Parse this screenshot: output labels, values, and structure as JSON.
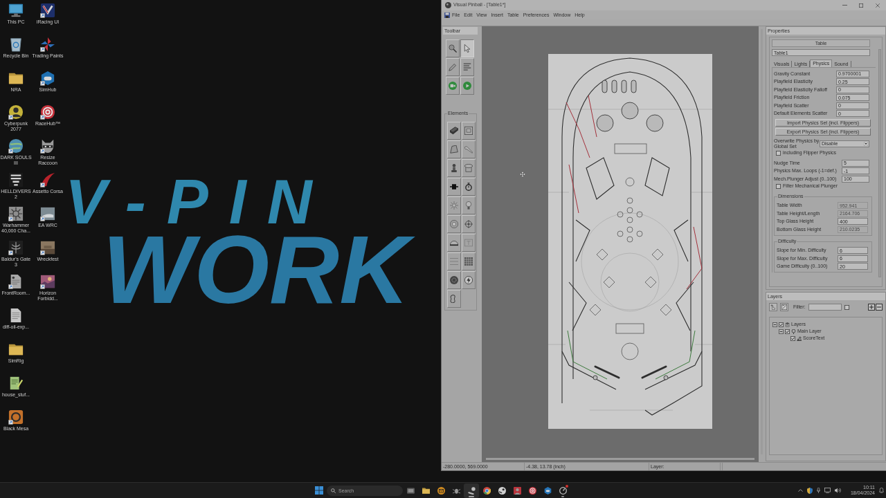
{
  "desktop": {
    "wallpaper_logo": [
      "V-PIN",
      "WORK"
    ],
    "icon_columns": [
      [
        {
          "label": "This PC",
          "kind": "monitor",
          "shortcut": false
        },
        {
          "label": "Recycle Bin",
          "kind": "bin",
          "shortcut": false
        },
        {
          "label": "NRA",
          "kind": "folder",
          "shortcut": false
        },
        {
          "label": "Cyberpunk 2077",
          "kind": "portrait",
          "shortcut": true
        },
        {
          "label": "DARK SOULS III",
          "kind": "globe",
          "shortcut": true
        },
        {
          "label": "HELLDIVERS 2",
          "kind": "emblem",
          "shortcut": false
        },
        {
          "label": "Warhammer 40,000 Cha...",
          "kind": "sun",
          "shortcut": true
        },
        {
          "label": "Baldur's Gate 3",
          "kind": "crest",
          "shortcut": true
        },
        {
          "label": "FrontRoom...",
          "kind": "imagefile",
          "shortcut": true
        },
        {
          "label": "diff-oil-exp...",
          "kind": "document",
          "shortcut": false
        },
        {
          "label": "SimRig",
          "kind": "folder",
          "shortcut": false
        },
        {
          "label": "house_stuf...",
          "kind": "notepad",
          "shortcut": false
        },
        {
          "label": "Black Mesa",
          "kind": "ringtile",
          "shortcut": true
        }
      ],
      [
        {
          "label": "iRacing UI",
          "kind": "shield",
          "shortcut": true
        },
        {
          "label": "Trading Paints",
          "kind": "pinwheel",
          "shortcut": true
        },
        {
          "label": "SimHub",
          "kind": "gamepad",
          "shortcut": true
        },
        {
          "label": "RaceHub™",
          "kind": "spiral",
          "shortcut": true
        },
        {
          "label": "Resize Raccoon",
          "kind": "mascot",
          "shortcut": true
        },
        {
          "label": "Assetto Corsa",
          "kind": "swoosh",
          "shortcut": true
        },
        {
          "label": "EA WRC",
          "kind": "rally",
          "shortcut": true
        },
        {
          "label": "Wreckfest",
          "kind": "wreck",
          "shortcut": true
        },
        {
          "label": "Horizon Forbidd...",
          "kind": "sunset",
          "shortcut": true
        }
      ]
    ]
  },
  "window": {
    "title": "Visual Pinball - [Table1*]",
    "menu": [
      "File",
      "Edit",
      "View",
      "Insert",
      "Table",
      "Preferences",
      "Window",
      "Help"
    ],
    "toolbar": {
      "title": "Toolbar",
      "tools": [
        {
          "kind": "magnifier",
          "selected": false
        },
        {
          "kind": "select",
          "selected": true
        },
        {
          "kind": "pencil",
          "selected": false
        },
        {
          "kind": "script",
          "selected": false
        },
        {
          "kind": "camera",
          "selected": false
        },
        {
          "kind": "play",
          "selected": false
        }
      ],
      "elements_title": "Elements",
      "elements": [
        {
          "kind": "wall",
          "selected": false
        },
        {
          "kind": "gate",
          "selected": false
        },
        {
          "kind": "ramp",
          "selected": false
        },
        {
          "kind": "flipper",
          "selected": false
        },
        {
          "kind": "plunger",
          "selected": false
        },
        {
          "kind": "bumper",
          "selected": false
        },
        {
          "kind": "spinner",
          "selected": false
        },
        {
          "kind": "timer",
          "selected": false
        },
        {
          "kind": "trigger",
          "selected": false
        },
        {
          "kind": "light",
          "selected": false
        },
        {
          "kind": "kicker",
          "selected": false
        },
        {
          "kind": "target",
          "selected": false
        },
        {
          "kind": "decal",
          "selected": false
        },
        {
          "kind": "textbox",
          "selected": false
        },
        {
          "kind": "reel",
          "selected": false
        },
        {
          "kind": "lightseq",
          "selected": false
        },
        {
          "kind": "primitive",
          "selected": false
        },
        {
          "kind": "flasher",
          "selected": false
        },
        {
          "kind": "rubber",
          "selected": false
        }
      ]
    },
    "properties": {
      "title": "Properties",
      "object_type": "Table",
      "object_name": "Table1",
      "tabs": [
        {
          "label": "Visuals",
          "selected": false
        },
        {
          "label": "Lights",
          "selected": false
        },
        {
          "label": "Physics",
          "selected": true
        },
        {
          "label": "Sound",
          "selected": false
        }
      ],
      "physics_fields": [
        {
          "label": "Gravity Constant",
          "value": "0.9700001",
          "disabled": false
        },
        {
          "label": "Playfield Elasticity",
          "value": "0.25",
          "disabled": false
        },
        {
          "label": "Playfield Elasticity Falloff",
          "value": "0",
          "disabled": false
        },
        {
          "label": "Playfield Friction",
          "value": "0.075",
          "disabled": false
        },
        {
          "label": "Playfield Scatter",
          "value": "0",
          "disabled": false
        },
        {
          "label": "Default Elements Scatter",
          "value": "0",
          "disabled": false
        }
      ],
      "buttons": [
        "Import Physics Set (incl. Flippers)",
        "Export Physics Set (incl. Flippers)"
      ],
      "overwrite": {
        "label": "Overwrite Physics by Global Set",
        "value": "Disable"
      },
      "flipper_option": {
        "label": "including Flipper Physics",
        "checked": false
      },
      "nudge_fields": [
        {
          "label": "Nudge Time",
          "value": "5",
          "disabled": false
        },
        {
          "label": "Physics Max. Loops (-1=def.)",
          "value": "-1",
          "disabled": false
        },
        {
          "label": "Mech.Plunger Adjust (0..100)",
          "value": "100",
          "disabled": false
        }
      ],
      "plunger_option": {
        "label": "Filter Mechanical Plunger",
        "checked": false
      },
      "groups": [
        {
          "title": "Dimensions",
          "fields": [
            {
              "label": "Table Width",
              "value": "952.941",
              "disabled": true
            },
            {
              "label": "Table Height/Length",
              "value": "2164.706",
              "disabled": true
            },
            {
              "label": "Top Glass Height",
              "value": "400",
              "disabled": false
            },
            {
              "label": "Bottom Glass Height",
              "value": "210.0235",
              "disabled": true
            }
          ]
        },
        {
          "title": "Difficulty",
          "fields": [
            {
              "label": "Slope for Min. Difficulty",
              "value": "6",
              "disabled": false
            },
            {
              "label": "Slope for Max. Difficulty",
              "value": "6",
              "disabled": false
            },
            {
              "label": "Game Difficulty (0..100)",
              "value": "20",
              "disabled": false
            }
          ]
        }
      ]
    },
    "layers": {
      "title": "Layers",
      "filter_label": "Filter:",
      "filter_option_checked": false,
      "tree": [
        {
          "label": "Layers",
          "kind": "stack",
          "checked": true,
          "expanded": true,
          "children": [
            {
              "label": "Main Layer",
              "kind": "pin",
              "checked": true,
              "expanded": true,
              "children": [
                {
                  "label": "ScoreText",
                  "kind": "shapes",
                  "checked": true
                }
              ]
            }
          ]
        }
      ]
    },
    "status_bar": [
      "-280.0000, 569.0000",
      "-4.38, 13.78 (inch)",
      "Layer:"
    ]
  },
  "taskbar": {
    "search_placeholder": "Search",
    "apps": [
      {
        "kind": "taskview",
        "active": false,
        "running": false,
        "badge": false
      },
      {
        "kind": "folder",
        "active": false,
        "running": false,
        "badge": false
      },
      {
        "kind": "mail",
        "active": false,
        "running": false,
        "badge": false
      },
      {
        "kind": "bug",
        "active": false,
        "running": false,
        "badge": false
      },
      {
        "kind": "pinball",
        "active": true,
        "running": true,
        "badge": false
      },
      {
        "kind": "chrome",
        "active": false,
        "running": false,
        "badge": false
      },
      {
        "kind": "roundlogo",
        "active": false,
        "running": false,
        "badge": false
      },
      {
        "kind": "avatar",
        "active": false,
        "running": false,
        "badge": false
      },
      {
        "kind": "spiral",
        "active": false,
        "running": false,
        "badge": false
      },
      {
        "kind": "gamepad",
        "active": false,
        "running": false,
        "badge": false
      },
      {
        "kind": "gauge",
        "active": false,
        "running": true,
        "badge": true
      }
    ],
    "clock": {
      "time": "10:11",
      "date": "18/04/2024"
    }
  }
}
